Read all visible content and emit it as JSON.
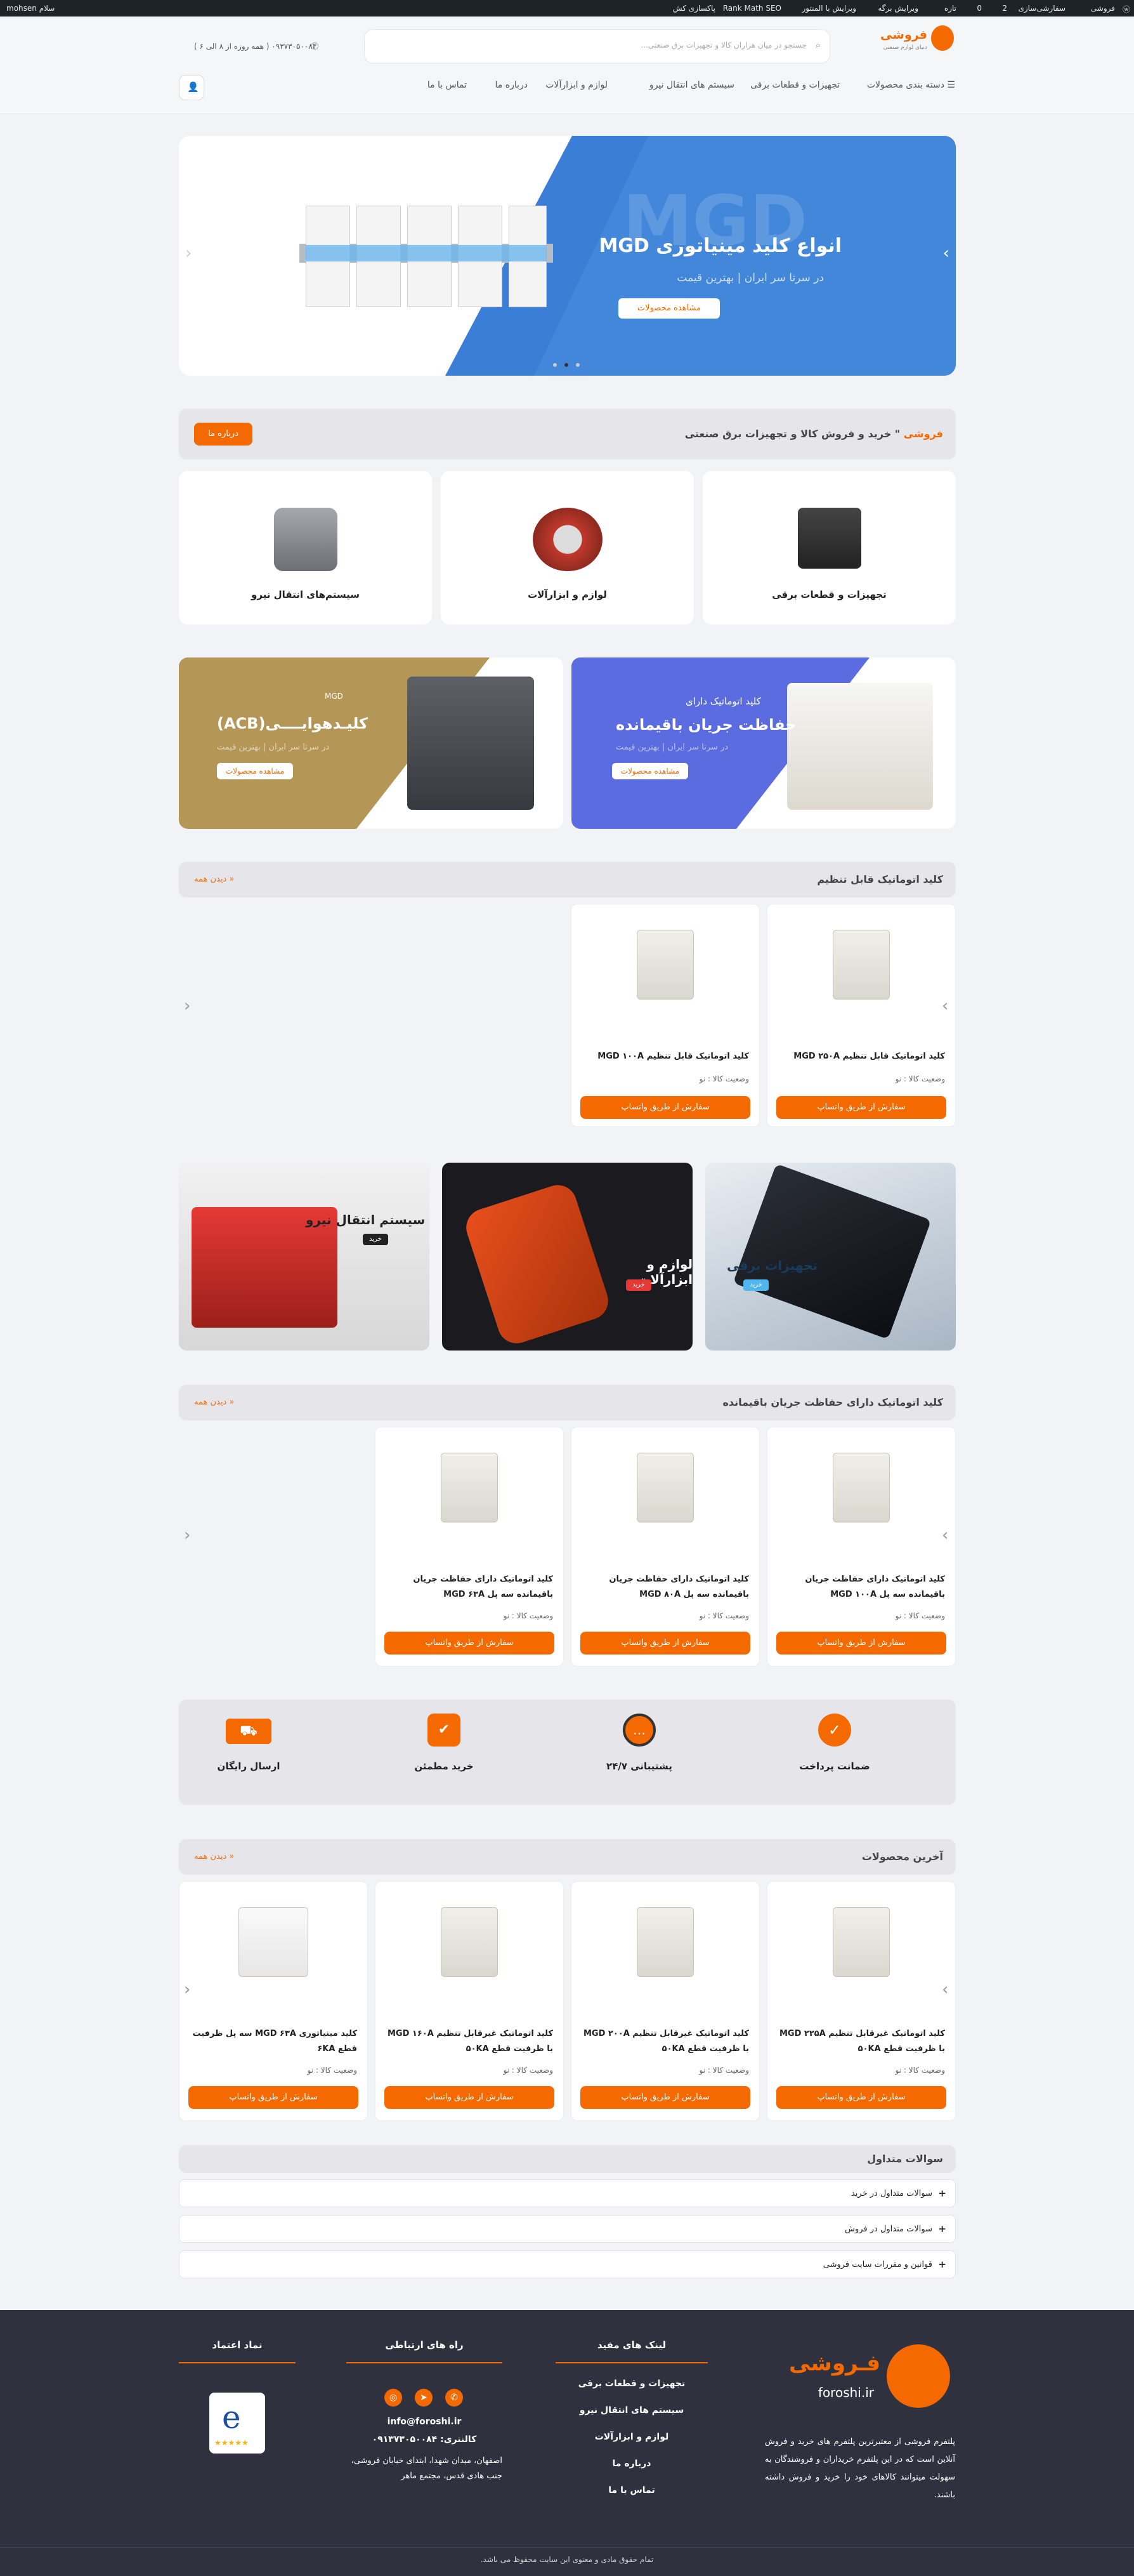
{
  "adminbar": {
    "site": "فروشی",
    "customize": "سفارشی‌سازی",
    "updates": "2",
    "comments": "0",
    "new": "تازه",
    "edit": "ویرایش برگه",
    "elementor": "ویرایش با المنتور",
    "rankmath": "Rank Math SEO",
    "cache": "پاکسازی کش",
    "greeting": "سلام mohsen"
  },
  "header": {
    "brand": "فروشی",
    "tagline": "دنیای لوازم صنعتی",
    "search_placeholder": "جستجو در میان هزاران کالا و تجهیزات برق صنعتی...",
    "phone": "۰۹۳۷۳۰۵۰۰۸۴ ( همه روزه از ۸ الی ۶ )",
    "categories_label": "دسته بندی محصولات",
    "nav": [
      "تجهیزات و قطعات برقی",
      "سیستم های انتقال نیرو",
      "لوازم و ابزارآلات",
      "درباره ما",
      "تماس با ما"
    ]
  },
  "hero": {
    "title": "انواع کلید مینیاتوری MGD",
    "subtitle": "در سرتا سر ایران | بهترین قیمت",
    "button": "مشاهده محصولات",
    "bg_text": "MGD"
  },
  "intro": {
    "text_brand": "فروشی",
    "text_rest": "\" خرید و فروش کالا و تجهیزات برق صنعتی",
    "button": "درباره ما"
  },
  "categories": [
    {
      "label": "تجهیزات و قطعات برقی",
      "icon": "inverter-icon"
    },
    {
      "label": "لوازم و ابزارآلات",
      "icon": "saw-icon"
    },
    {
      "label": "سیستم‌های انتقال نیرو",
      "icon": "gearbox-icon"
    }
  ],
  "banners": {
    "rcd": {
      "line1": "کلید اتوماتیک دارای",
      "line2": "حفاظت جریان باقیمانده",
      "line3": "در سرتا سر ایران | بهترین قیمت",
      "button": "مشاهده محصولات"
    },
    "acb": {
      "brand": "MGD",
      "line1": "کلیـدهوایــــی(ACB)",
      "line3": "در سرتا سر ایران | بهترین قیمت",
      "button": "مشاهده محصولات"
    }
  },
  "sections": {
    "adjustable": {
      "title": "کلید اتوماتیک قابل تنظیم",
      "view_all": "دیدن همه",
      "products": [
        {
          "name": "کلید اتوماتیک قابل تنظیم MGD ۲۵۰A",
          "status": "وضعیت کالا : نو",
          "button": "سفارش از طریق واتساپ"
        },
        {
          "name": "کلید اتوماتیک قابل تنظیم MGD ۱۰۰A",
          "status": "وضعیت کالا : نو",
          "button": "سفارش از طریق واتساپ"
        }
      ]
    },
    "rcd": {
      "title": "کلید اتوماتیک دارای حفاظت جریان باقیمانده",
      "view_all": "دیدن همه",
      "products": [
        {
          "name": "کلید اتوماتیک دارای حفاظت جریان باقیمانده سه پل MGD ۱۰۰A",
          "status": "وضعیت کالا : نو",
          "button": "سفارش از طریق واتساپ"
        },
        {
          "name": "کلید اتوماتیک دارای حفاظت جریان باقیمانده سه پل MGD ۸۰A",
          "status": "وضعیت کالا : نو",
          "button": "سفارش از طریق واتساپ"
        },
        {
          "name": "کلید اتوماتیک دارای حفاظت جریان باقیمانده سه پل MGD ۶۳A",
          "status": "وضعیت کالا : نو",
          "button": "سفارش از طریق واتساپ"
        }
      ]
    },
    "latest": {
      "title": "آخرین محصولات",
      "view_all": "دیدن همه",
      "products": [
        {
          "name": "کلید اتوماتیک غیرقابل تنظیم MGD ۲۲۵A با ظرفیت قطع ۵۰KA",
          "status": "وضعیت کالا : نو",
          "button": "سفارش از طریق واتساپ"
        },
        {
          "name": "کلید اتوماتیک غیرقابل تنظیم MGD ۲۰۰A با ظرفیت قطع ۵۰KA",
          "status": "وضعیت کالا : نو",
          "button": "سفارش از طریق واتساپ"
        },
        {
          "name": "کلید اتوماتیک غیرقابل تنظیم MGD ۱۶۰A با ظرفیت قطع ۵۰KA",
          "status": "وضعیت کالا : نو",
          "button": "سفارش از طریق واتساپ"
        },
        {
          "name": "کلید مینیاتوری MGD ۶۳A سه پل ظرفیت قطع ۶KA",
          "status": "وضعیت کالا : نو",
          "button": "سفارش از طریق واتساپ"
        }
      ]
    }
  },
  "promo_tiles": [
    {
      "title": "تجهیزات برقی",
      "button": "خرید"
    },
    {
      "title": "لوازم و ابزارآلات",
      "button": "خرید"
    },
    {
      "title": "سیستم انتقال نیرو",
      "button": "خرید"
    }
  ],
  "features": [
    {
      "label": "ضمانت پرداخت",
      "icon": "guarantee-icon"
    },
    {
      "label": "پشتیبانی ۲۴/۷",
      "icon": "support-icon"
    },
    {
      "label": "خرید مطمئن",
      "icon": "secure-bag-icon"
    },
    {
      "label": "ارسال رایگان",
      "icon": "truck-icon"
    }
  ],
  "faq": {
    "title": "سوالات متداول",
    "items": [
      "سوالات متداول در خرید",
      "سوالات متداول در فروش",
      "قوانین و مقررات سایت فروشی"
    ]
  },
  "footer": {
    "brand": "فـروشی",
    "domain": "foroshi.ir",
    "about": "پلتفرم فروشی از معتبرترین پلتفرم های خرید و فروش آنلاین است که در این پلتفرم خریداران و فروشندگان به سهولت میتوانند کالاهای خود را خرید و فروش داشته باشند.",
    "links_title": "لینک های مفید",
    "links": [
      "تجهیزات و قطعات برقی",
      "سیستم های انتقال نیرو",
      "لوازم و ابزارآلات",
      "درباره ما",
      "تماس با ما"
    ],
    "contact_title": "راه های ارتباطی",
    "email": "info@foroshi.ir",
    "phone": "کالنتری: ۰۹۱۳۷۳۰۵۰۰۸۴",
    "address": "اصفهان، میدان شهدا، ابتدای خیابان فروشی، جنب هادی قدس، مجتمع ماهر",
    "trust_title": "نماد اعتماد",
    "copyright": "تمام حقوق مادی و معنوی این سایت محفوظ می باشد."
  },
  "colors": {
    "accent": "#f56a00",
    "hero_blue": "#3a7fd5",
    "footer_bg": "#30313f"
  }
}
